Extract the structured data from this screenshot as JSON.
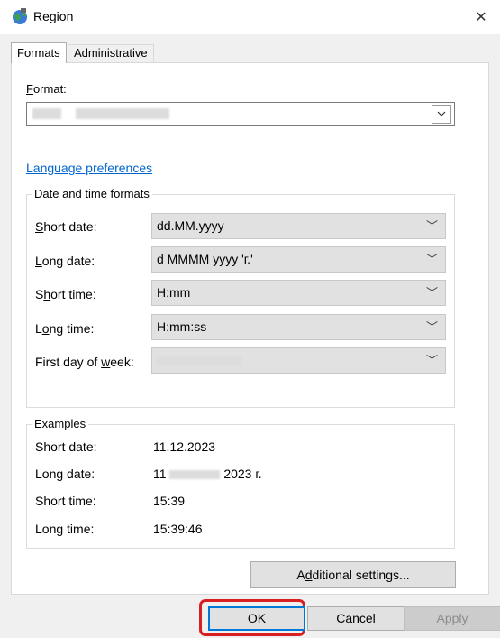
{
  "window": {
    "title": "Region",
    "close_glyph": "✕",
    "icon": "region-globe-icon"
  },
  "tabs": [
    "Formats",
    "Administrative"
  ],
  "format": {
    "label": "Format:",
    "value": ""
  },
  "language_link": "Language preferences",
  "date_time": {
    "legend": "Date and time formats",
    "rows": [
      {
        "label": "Short date:",
        "value": "dd.MM.yyyy"
      },
      {
        "label": "Long date:",
        "value": "d MMMM yyyy 'г.'"
      },
      {
        "label": "Short time:",
        "value": "H:mm"
      },
      {
        "label": "Long time:",
        "value": "H:mm:ss"
      },
      {
        "label": "First day of week:",
        "value": ""
      }
    ]
  },
  "examples": {
    "legend": "Examples",
    "rows": [
      {
        "label": "Short date:",
        "value": "11.12.2023"
      },
      {
        "label": "Long date:",
        "value_prefix": "11",
        "value_suffix": "2023 г."
      },
      {
        "label": "Short time:",
        "value": "15:39"
      },
      {
        "label": "Long time:",
        "value": "15:39:46"
      }
    ]
  },
  "buttons": {
    "additional": "Additional settings...",
    "ok": "OK",
    "cancel": "Cancel",
    "apply": "Apply"
  },
  "colors": {
    "link": "#0066cc",
    "focus": "#0078d7",
    "highlight": "#d92020"
  }
}
